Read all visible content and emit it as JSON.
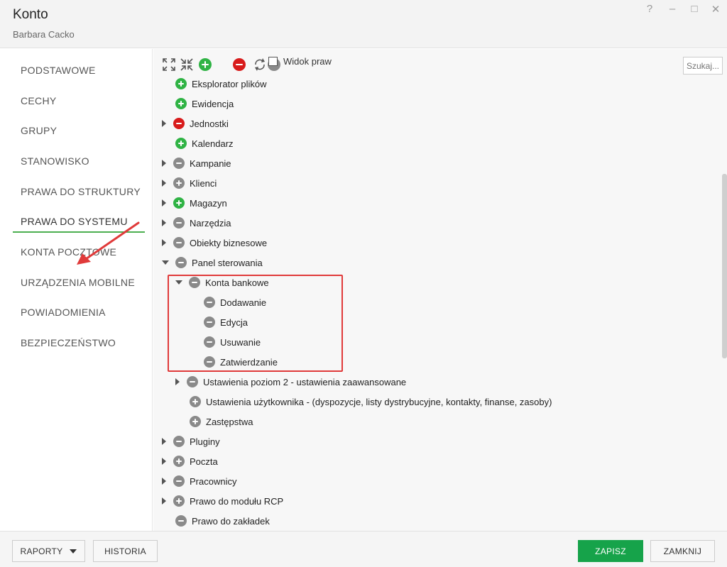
{
  "window": {
    "title": "Konto",
    "subtitle": "Barbara Cacko",
    "controls": {
      "help": "?",
      "minimize": "–",
      "maximize": "□",
      "close": "✕"
    }
  },
  "sidebar": {
    "items": [
      {
        "label": "PODSTAWOWE",
        "active": false
      },
      {
        "label": "CECHY",
        "active": false
      },
      {
        "label": "GRUPY",
        "active": false
      },
      {
        "label": "STANOWISKO",
        "active": false
      },
      {
        "label": "PRAWA DO STRUKTURY",
        "active": false
      },
      {
        "label": "PRAWA DO SYSTEMU",
        "active": true
      },
      {
        "label": "KONTA POCZTOWE",
        "active": false
      },
      {
        "label": "URZĄDZENIA MOBILNE",
        "active": false
      },
      {
        "label": "POWIADOMIENIA",
        "active": false
      },
      {
        "label": "BEZPIECZEŃSTWO",
        "active": false
      }
    ]
  },
  "toolbar": {
    "widok_label": "Widok praw",
    "search_placeholder": "Szukaj..."
  },
  "tree": {
    "items": [
      {
        "label": "Eksplorator plików",
        "state": "plus-green",
        "expander": "none",
        "level": 0
      },
      {
        "label": "Ewidencja",
        "state": "plus-green",
        "expander": "none",
        "level": 0
      },
      {
        "label": "Jednostki",
        "state": "minus-red",
        "expander": "collapsed",
        "level": 0
      },
      {
        "label": "Kalendarz",
        "state": "plus-green",
        "expander": "none",
        "level": 0
      },
      {
        "label": "Kampanie",
        "state": "minus-gray",
        "expander": "collapsed",
        "level": 0
      },
      {
        "label": "Klienci",
        "state": "plus-gray",
        "expander": "collapsed",
        "level": 0
      },
      {
        "label": "Magazyn",
        "state": "plus-green",
        "expander": "collapsed",
        "level": 0
      },
      {
        "label": "Narzędzia",
        "state": "minus-gray",
        "expander": "collapsed",
        "level": 0
      },
      {
        "label": "Obiekty biznesowe",
        "state": "minus-gray",
        "expander": "collapsed",
        "level": 0
      },
      {
        "label": "Panel sterowania",
        "state": "minus-gray",
        "expander": "expanded",
        "level": 0
      },
      {
        "label": "Konta bankowe",
        "state": "minus-gray",
        "expander": "expanded",
        "level": 1
      },
      {
        "label": "Dodawanie",
        "state": "minus-gray",
        "expander": "none",
        "level": 2
      },
      {
        "label": "Edycja",
        "state": "minus-gray",
        "expander": "none",
        "level": 2
      },
      {
        "label": "Usuwanie",
        "state": "minus-gray",
        "expander": "none",
        "level": 2
      },
      {
        "label": "Zatwierdzanie",
        "state": "minus-gray",
        "expander": "none",
        "level": 2
      },
      {
        "label": "Ustawienia poziom 2 - ustawienia zaawansowane",
        "state": "minus-gray",
        "expander": "collapsed",
        "level": 1
      },
      {
        "label": "Ustawienia użytkownika - (dyspozycje, listy dystrybucyjne, kontakty, finanse, zasoby)",
        "state": "plus-gray",
        "expander": "none",
        "level": 1
      },
      {
        "label": "Zastępstwa",
        "state": "plus-gray",
        "expander": "none",
        "level": 1
      },
      {
        "label": "Pluginy",
        "state": "minus-gray",
        "expander": "collapsed",
        "level": 0
      },
      {
        "label": "Poczta",
        "state": "plus-gray",
        "expander": "collapsed",
        "level": 0
      },
      {
        "label": "Pracownicy",
        "state": "minus-gray",
        "expander": "collapsed",
        "level": 0
      },
      {
        "label": "Prawo do modułu RCP",
        "state": "plus-gray",
        "expander": "collapsed",
        "level": 0
      },
      {
        "label": "Prawo do zakładek",
        "state": "minus-gray",
        "expander": "none",
        "level": 0
      }
    ]
  },
  "footer": {
    "raporty_label": "RAPORTY",
    "historia_label": "HISTORIA",
    "zapisz_label": "ZAPISZ",
    "zamknij_label": "ZAMKNIJ"
  },
  "colors": {
    "green": "#2fb344",
    "red": "#d81b1b",
    "gray": "#8a8a8a",
    "primary_button": "#16a34a",
    "highlight_box": "#e03a3a",
    "active_tab_underline": "#4caf50"
  }
}
